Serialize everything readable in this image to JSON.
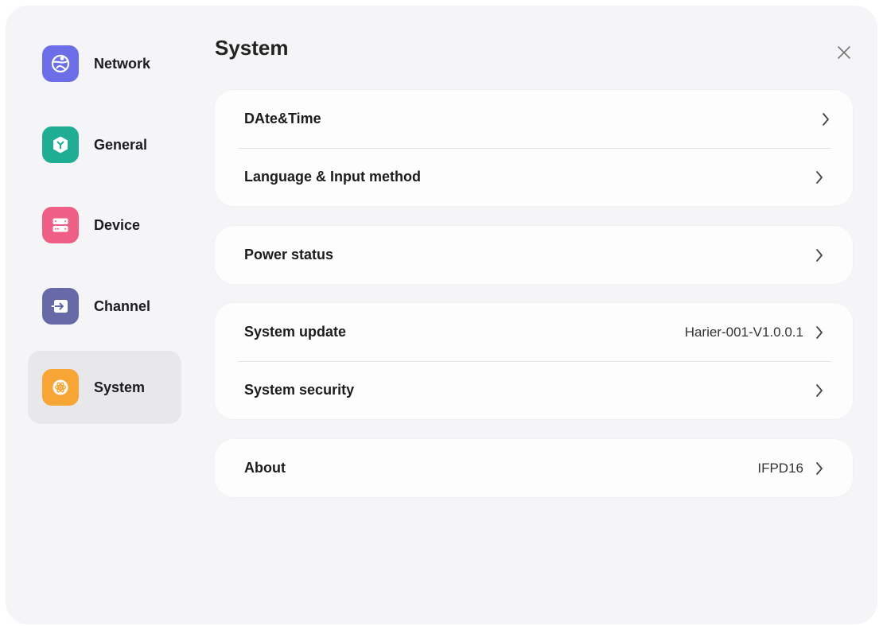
{
  "sidebar": {
    "items": [
      {
        "label": "Network",
        "icon": "network-icon",
        "color": "#6b6ee6"
      },
      {
        "label": "General",
        "icon": "general-icon",
        "color": "#1fae93"
      },
      {
        "label": "Device",
        "icon": "device-icon",
        "color": "#ef5f85"
      },
      {
        "label": "Channel",
        "icon": "channel-icon",
        "color": "#686aa8"
      },
      {
        "label": "System",
        "icon": "system-icon",
        "color": "#f7a535",
        "active": true
      }
    ]
  },
  "header": {
    "title": "System",
    "close_icon": "close-icon"
  },
  "sections": {
    "datetime": {
      "label": "DAte&Time"
    },
    "language": {
      "label": "Language & Input method"
    },
    "power": {
      "label": "Power status"
    },
    "update": {
      "label": "System update",
      "value": "Harier-001-V1.0.0.1"
    },
    "security": {
      "label": "System security"
    },
    "about": {
      "label": "About",
      "value": "IFPD16"
    }
  },
  "colors": {
    "background": "#f5f5f7",
    "card": "#fdfdfe",
    "active_nav": "#e8e8ea"
  }
}
